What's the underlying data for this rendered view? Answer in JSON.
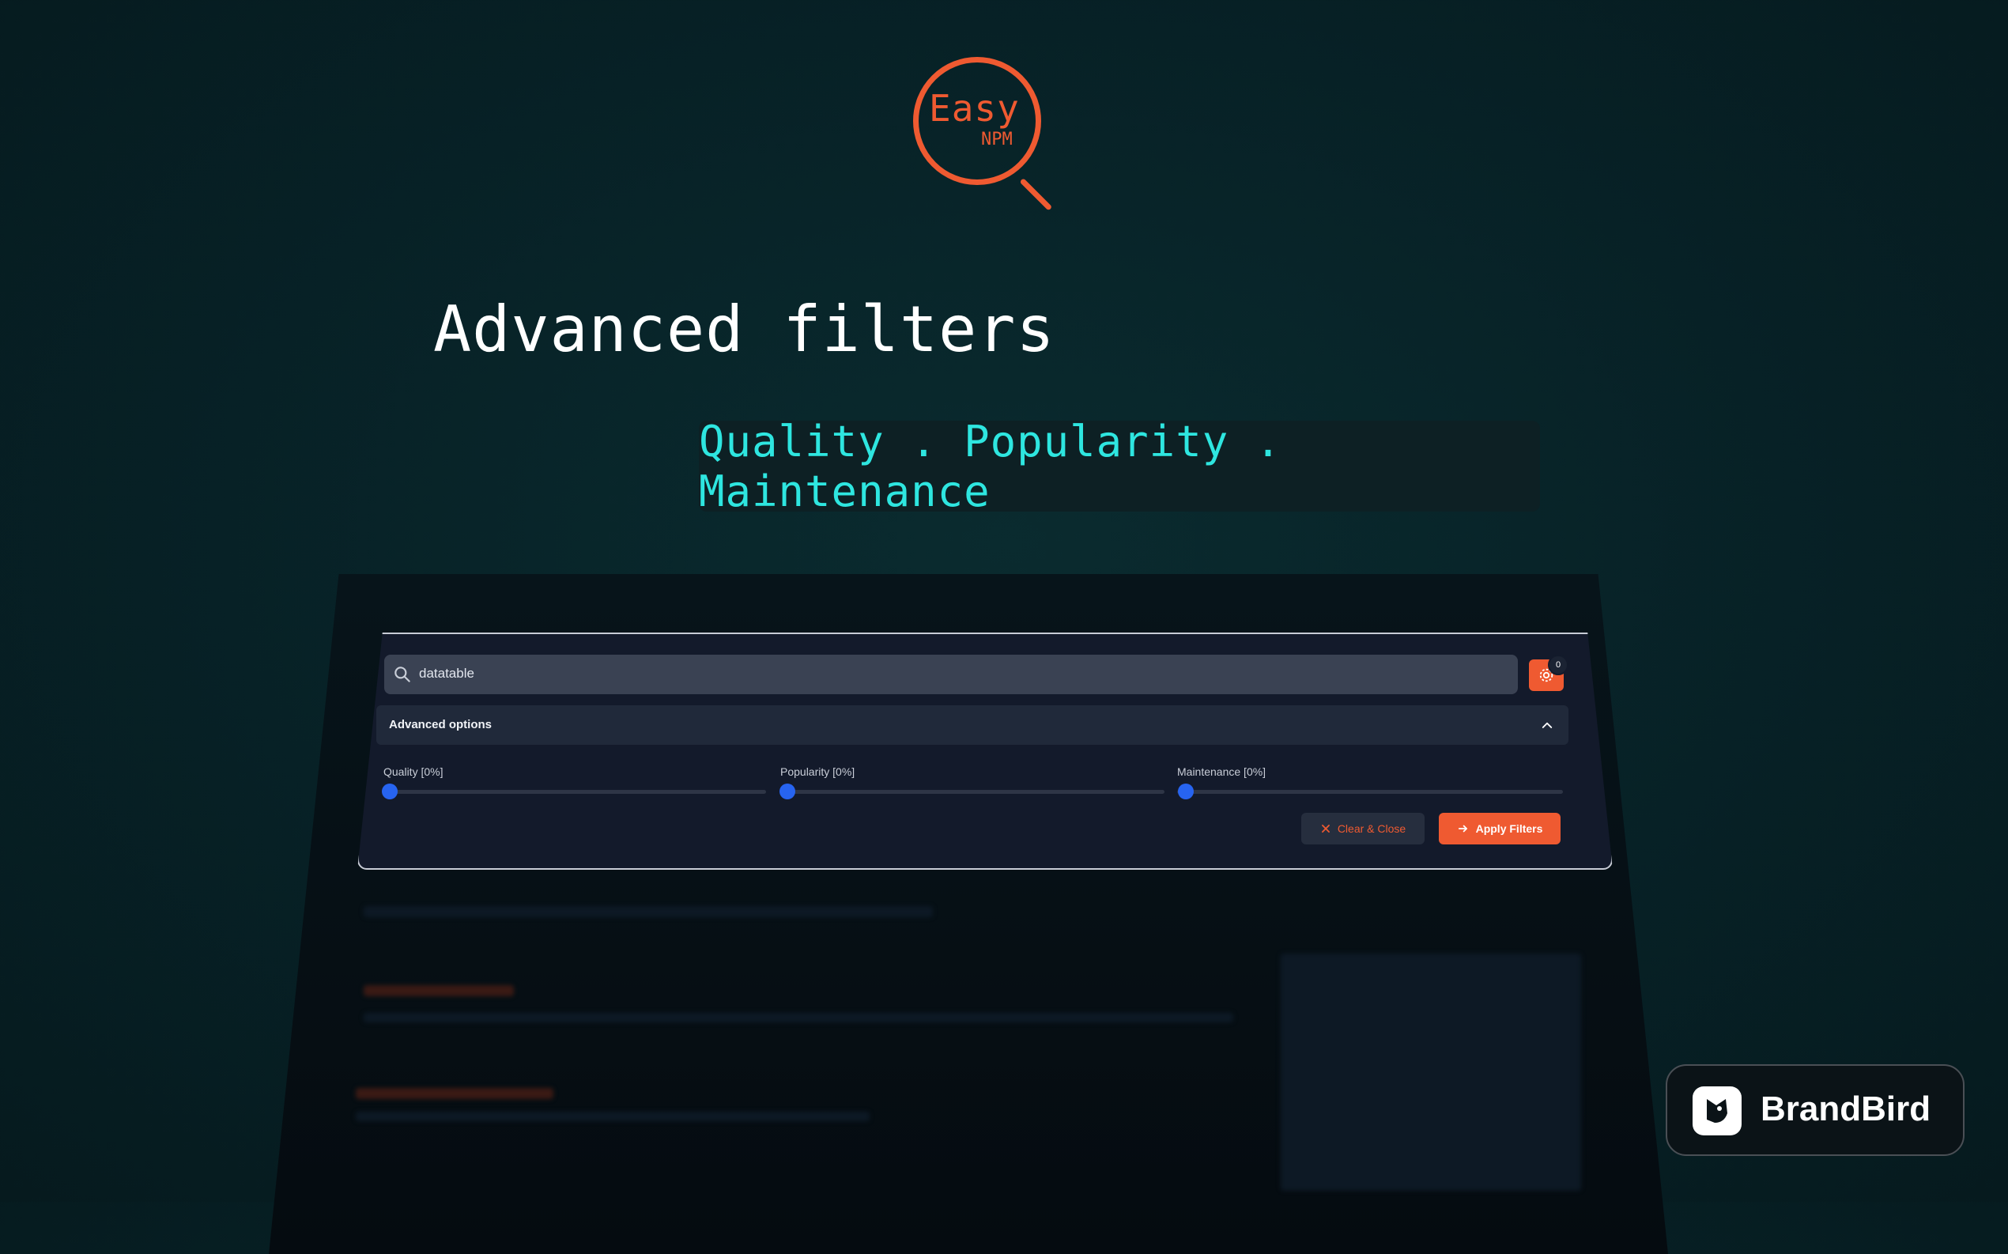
{
  "logo": {
    "title": "Easy",
    "subtitle": "NPM"
  },
  "headline": "Advanced filters",
  "tagline": "Quality . Popularity . Maintenance",
  "search": {
    "value": "datatable"
  },
  "settings_badge": "0",
  "advanced": {
    "label": "Advanced options"
  },
  "sliders": [
    {
      "label": "Quality [0%]",
      "value": 0
    },
    {
      "label": "Popularity [0%]",
      "value": 0
    },
    {
      "label": "Maintenance [0%]",
      "value": 0
    }
  ],
  "buttons": {
    "clear": "Clear & Close",
    "apply": "Apply Filters"
  },
  "brand": {
    "name": "BrandBird"
  },
  "colors": {
    "accent": "#ef5a31",
    "teal": "#2ee6e0",
    "knob": "#2764f0",
    "panel": "#131a2b"
  }
}
